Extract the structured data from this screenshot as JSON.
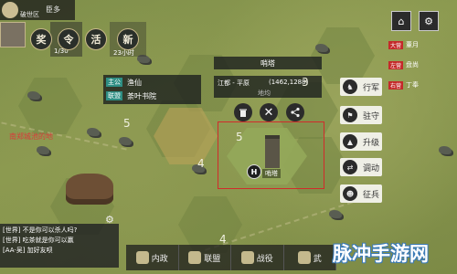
{
  "top": {
    "city_label": "破世区",
    "back_label": "臣多",
    "counter_main": "1/30",
    "counter_sub": "23小时"
  },
  "round_buttons": [
    {
      "label": "奖",
      "name": "reward-button"
    },
    {
      "label": "令",
      "name": "order-button"
    },
    {
      "label": "活",
      "name": "activity-button"
    },
    {
      "label": "新",
      "name": "new-button"
    }
  ],
  "left_info": {
    "lord_key": "主公",
    "lord_value": "渔仙",
    "alliance_key": "联盟",
    "alliance_value": "荼叶书院"
  },
  "location": {
    "name": "哨塔",
    "area": "江都 - 平原",
    "coords": "(1462,1288)",
    "extra": "地均"
  },
  "selected_tile_label": "哨塔",
  "selected_tile_badge": "H",
  "tile_numbers": [
    "5",
    "5",
    "4",
    "3",
    "4"
  ],
  "red_map_text": "南郑城池的地",
  "actions": [
    {
      "label": "行军",
      "icon": "march-icon"
    },
    {
      "label": "驻守",
      "icon": "garrison-icon"
    },
    {
      "label": "升级",
      "icon": "upgrade-icon"
    },
    {
      "label": "调动",
      "icon": "transfer-icon"
    },
    {
      "label": "征兵",
      "icon": "recruit-icon"
    }
  ],
  "right_list": [
    {
      "tag": "大营",
      "text": "董月"
    },
    {
      "tag": "左营",
      "text": "盘尚"
    },
    {
      "tag": "右营",
      "text": "丁奉"
    }
  ],
  "chat": {
    "lines": [
      "[世界] 不是你可以杀人吗?",
      "[世界] 吃茶就是你可以赢",
      "[AA·吴] 加好友呗"
    ]
  },
  "bottom_bar": [
    {
      "label": "内政",
      "name": "domestic-button"
    },
    {
      "label": "联盟",
      "name": "alliance-button"
    },
    {
      "label": "战役",
      "name": "campaign-button"
    },
    {
      "label": "武",
      "name": "general-button"
    }
  ],
  "watermark": "脉冲手游网",
  "colors": {
    "selection_border": "#d12b2b",
    "red_text": "#d93a3a",
    "panel": "#1e2323"
  }
}
